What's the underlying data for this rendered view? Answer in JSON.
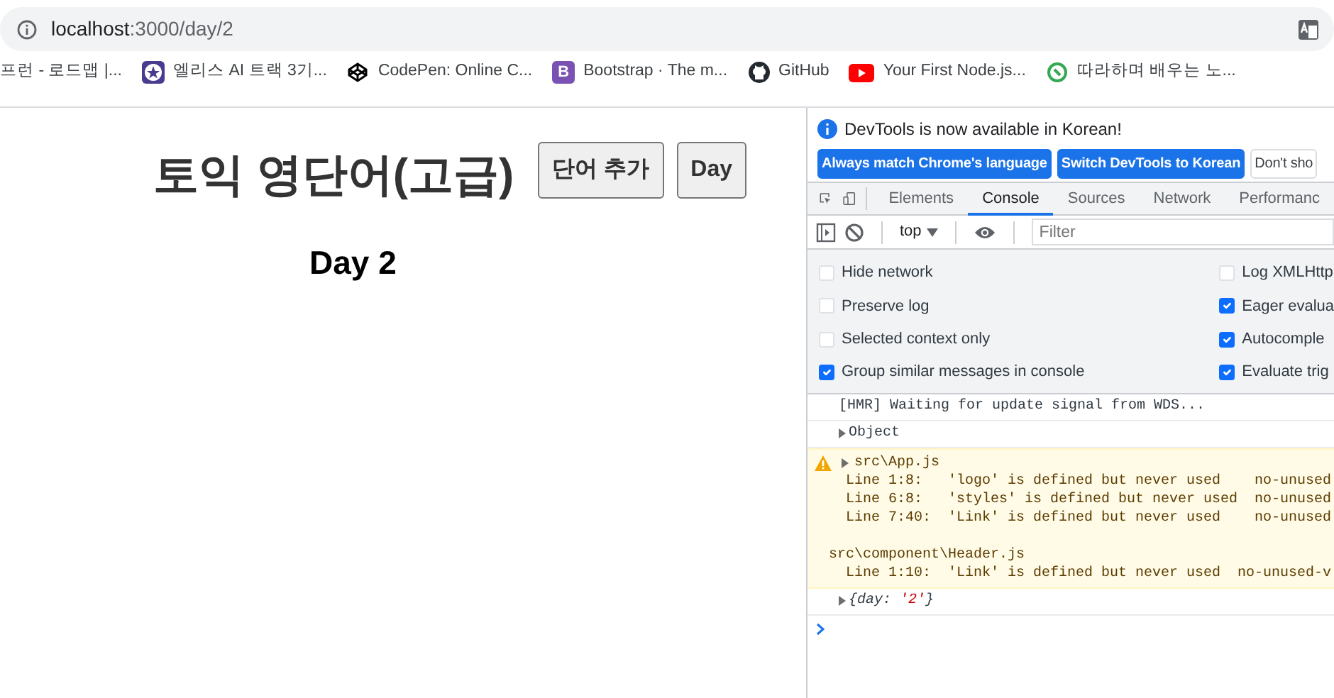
{
  "address_bar": {
    "host": "localhost",
    "path": ":3000/day/2"
  },
  "bookmarks": [
    {
      "kind": "plain",
      "label": "프런 - 로드맵 |..."
    },
    {
      "kind": "star",
      "label": "엘리스 AI 트랙 3기..."
    },
    {
      "kind": "cube",
      "label": "CodePen: Online C..."
    },
    {
      "kind": "letter",
      "glyph": "B",
      "label": "Bootstrap · The m..."
    },
    {
      "kind": "cat",
      "label": "GitHub"
    },
    {
      "kind": "play",
      "label": "Your First Node.js..."
    },
    {
      "kind": "ring",
      "label": "따라하며 배우는 노..."
    }
  ],
  "page": {
    "title": "토익 영단어(고급)",
    "buttons": [
      "단어 추가",
      "Day"
    ],
    "day_heading": "Day 2"
  },
  "devtools": {
    "notice": {
      "text": "DevTools is now available in Korean!",
      "buttons": [
        {
          "label": "Always match Chrome's language",
          "primary": true
        },
        {
          "label": "Switch DevTools to Korean",
          "primary": true
        },
        {
          "label": "Don't sho",
          "primary": false
        }
      ]
    },
    "tabs": [
      {
        "label": "Elements",
        "selected": false
      },
      {
        "label": "Console",
        "selected": true
      },
      {
        "label": "Sources",
        "selected": false
      },
      {
        "label": "Network",
        "selected": false
      },
      {
        "label": "Performanc",
        "selected": false
      }
    ],
    "toolbar": {
      "context": "top",
      "filter_placeholder": "Filter"
    },
    "settings_left": [
      {
        "label": "Hide network",
        "checked": false
      },
      {
        "label": "Preserve log",
        "checked": false
      },
      {
        "label": "Selected context only",
        "checked": false
      },
      {
        "label": "Group similar messages in console",
        "checked": true
      }
    ],
    "settings_right": [
      {
        "label": "Log XMLHttp",
        "checked": false
      },
      {
        "label": "Eager evalua",
        "checked": true
      },
      {
        "label": "Autocomple",
        "checked": true
      },
      {
        "label": "Evaluate trig",
        "checked": true
      }
    ],
    "messages": [
      {
        "kind": "log",
        "text": "[HMR] Waiting for update signal from WDS..."
      },
      {
        "kind": "object",
        "parts": [
          {
            "text": "Object",
            "kind": "plain"
          }
        ]
      },
      {
        "kind": "warning",
        "title": "src\\App.js",
        "blocks": [
          [
            "  Line 1:8:   'logo' is defined but never used    no-unused",
            "  Line 6:8:   'styles' is defined but never used  no-unused",
            "  Line 7:40:  'Link' is defined but never used    no-unused"
          ],
          [
            "src\\component\\Header.js",
            "  Line 1:10:  'Link' is defined but never used  no-unused-v"
          ]
        ]
      },
      {
        "kind": "object",
        "italic": true,
        "parts": [
          {
            "text": "{day: ",
            "kind": "plain"
          },
          {
            "text": "'2'",
            "kind": "string"
          },
          {
            "text": "}",
            "kind": "plain"
          }
        ]
      },
      {
        "kind": "prompt"
      }
    ]
  }
}
